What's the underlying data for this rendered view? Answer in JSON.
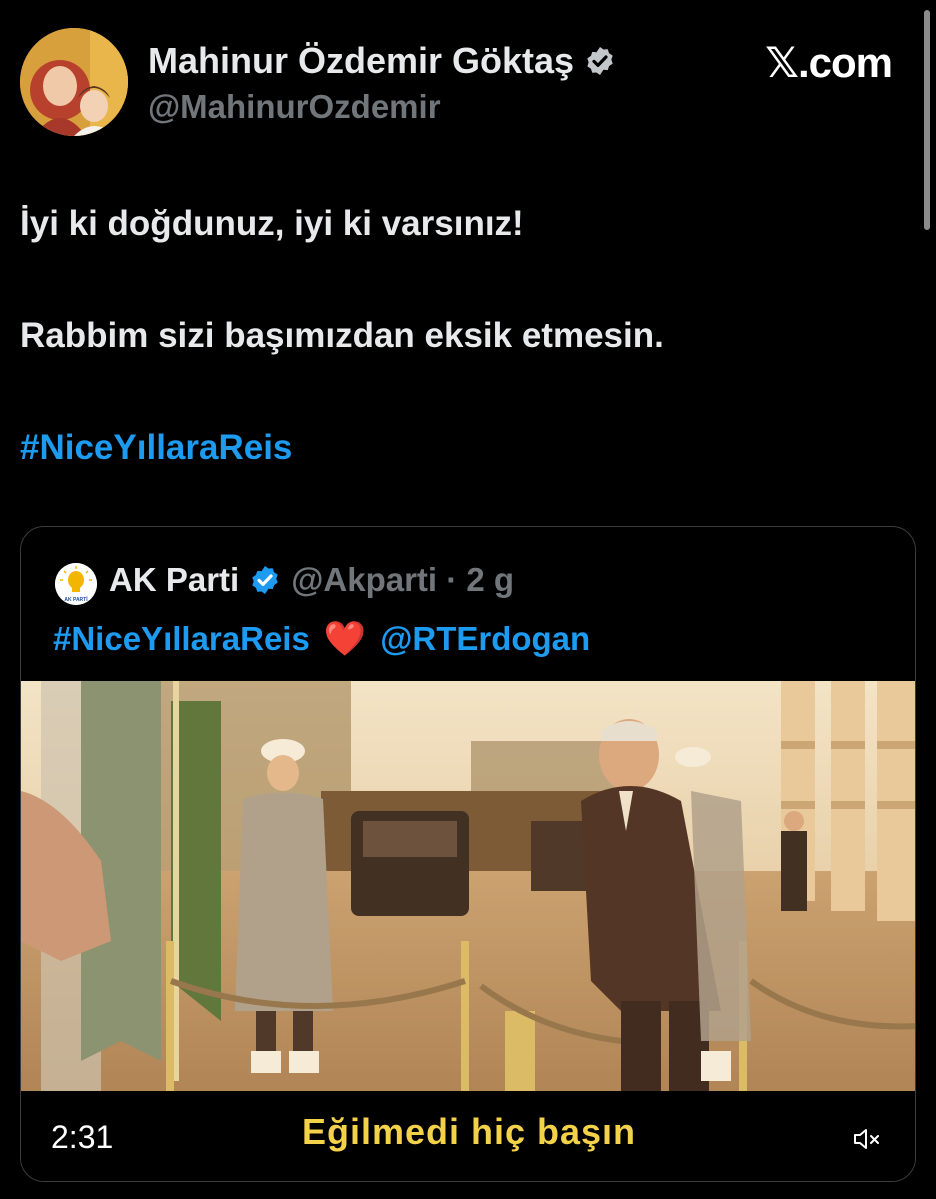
{
  "author": {
    "name": "Mahinur Özdemir Göktaş",
    "handle": "@MahinurOzdemir"
  },
  "site_logo": "𝕏.com",
  "tweet": {
    "line1": "İyi ki doğdunuz, iyi ki varsınız!",
    "line2": "Rabbim sizi başımızdan eksik etmesin.",
    "hashtag": "#NiceYıllaraReis"
  },
  "quote": {
    "name": "AK Parti",
    "meta": "@Akparti · 2 g",
    "hashtag": "#NiceYıllaraReis",
    "heart": "❤️",
    "mention": "@RTErdogan",
    "logo_caption": "AK PARTİ"
  },
  "video": {
    "time": "2:31",
    "subtitle": "Eğilmedi hiç başın"
  },
  "colors": {
    "background": "#000000",
    "text": "#e7e9ea",
    "secondary": "#71767b",
    "link": "#1d9bf0",
    "subtitle": "#f3d24a"
  },
  "icons": [
    "verified-badge-icon",
    "mute-icon",
    "scrollbar"
  ]
}
